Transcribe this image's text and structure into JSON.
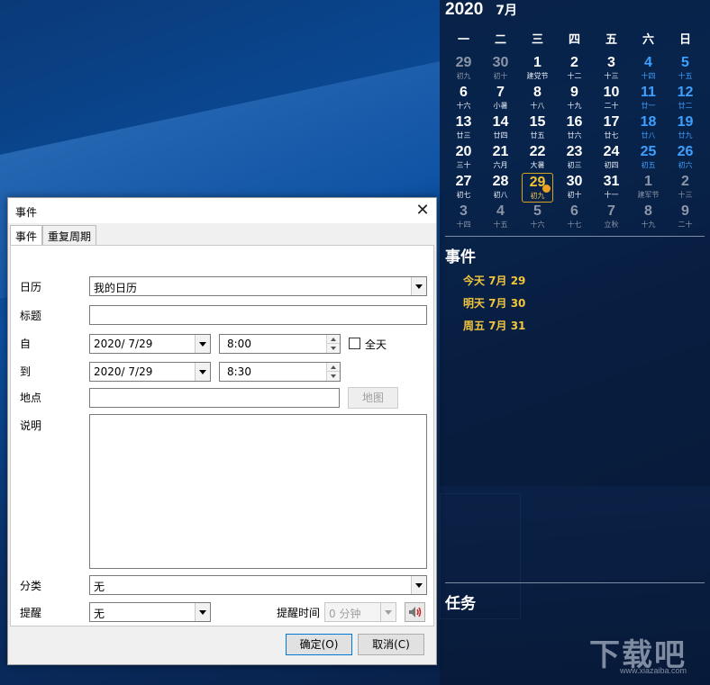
{
  "calendar": {
    "year": "2020",
    "month": "7月",
    "weekdays": [
      "一",
      "二",
      "三",
      "四",
      "五",
      "六",
      "日"
    ],
    "days": [
      {
        "n": "29",
        "l": "初九",
        "t": "other"
      },
      {
        "n": "30",
        "l": "初十",
        "t": "other"
      },
      {
        "n": "1",
        "l": "建党节",
        "t": "normal"
      },
      {
        "n": "2",
        "l": "十二",
        "t": "normal"
      },
      {
        "n": "3",
        "l": "十三",
        "t": "normal"
      },
      {
        "n": "4",
        "l": "十四",
        "t": "weekend"
      },
      {
        "n": "5",
        "l": "十五",
        "t": "weekend"
      },
      {
        "n": "6",
        "l": "十六",
        "t": "normal"
      },
      {
        "n": "7",
        "l": "小暑",
        "t": "normal"
      },
      {
        "n": "8",
        "l": "十八",
        "t": "normal"
      },
      {
        "n": "9",
        "l": "十九",
        "t": "normal"
      },
      {
        "n": "10",
        "l": "二十",
        "t": "normal"
      },
      {
        "n": "11",
        "l": "廿一",
        "t": "weekend"
      },
      {
        "n": "12",
        "l": "廿二",
        "t": "weekend"
      },
      {
        "n": "13",
        "l": "廿三",
        "t": "normal"
      },
      {
        "n": "14",
        "l": "廿四",
        "t": "normal"
      },
      {
        "n": "15",
        "l": "廿五",
        "t": "normal"
      },
      {
        "n": "16",
        "l": "廿六",
        "t": "normal"
      },
      {
        "n": "17",
        "l": "廿七",
        "t": "normal"
      },
      {
        "n": "18",
        "l": "廿八",
        "t": "weekend"
      },
      {
        "n": "19",
        "l": "廿九",
        "t": "weekend"
      },
      {
        "n": "20",
        "l": "三十",
        "t": "normal"
      },
      {
        "n": "21",
        "l": "六月",
        "t": "normal"
      },
      {
        "n": "22",
        "l": "大暑",
        "t": "normal"
      },
      {
        "n": "23",
        "l": "初三",
        "t": "normal"
      },
      {
        "n": "24",
        "l": "初四",
        "t": "normal"
      },
      {
        "n": "25",
        "l": "初五",
        "t": "weekend"
      },
      {
        "n": "26",
        "l": "初六",
        "t": "weekend"
      },
      {
        "n": "27",
        "l": "初七",
        "t": "normal"
      },
      {
        "n": "28",
        "l": "初八",
        "t": "normal"
      },
      {
        "n": "29",
        "l": "初九",
        "t": "today"
      },
      {
        "n": "30",
        "l": "初十",
        "t": "normal"
      },
      {
        "n": "31",
        "l": "十一",
        "t": "normal"
      },
      {
        "n": "1",
        "l": "建军节",
        "t": "other"
      },
      {
        "n": "2",
        "l": "十三",
        "t": "other"
      },
      {
        "n": "3",
        "l": "十四",
        "t": "other"
      },
      {
        "n": "4",
        "l": "十五",
        "t": "other"
      },
      {
        "n": "5",
        "l": "十六",
        "t": "other"
      },
      {
        "n": "6",
        "l": "十七",
        "t": "other"
      },
      {
        "n": "7",
        "l": "立秋",
        "t": "other"
      },
      {
        "n": "8",
        "l": "十九",
        "t": "other"
      },
      {
        "n": "9",
        "l": "二十",
        "t": "other"
      }
    ],
    "events_title": "事件",
    "events": [
      "今天 7月 29",
      "明天 7月 30",
      "周五 7月 31"
    ],
    "tasks_title": "任务",
    "colors": {
      "weekend": "#3ea0ff",
      "today": "#f5c232",
      "event_text": "#f2c53b"
    }
  },
  "dialog": {
    "title": "事件",
    "tabs": [
      "事件",
      "重复周期"
    ],
    "calendar_label": "日历",
    "calendar_value": "我的日历",
    "title_label": "标题",
    "title_value": "",
    "from_label": "自",
    "from_date": "2020/  7/29",
    "from_time": "8:00",
    "allday_label": "全天",
    "to_label": "到",
    "to_date": "2020/  7/29",
    "to_time": "8:30",
    "location_label": "地点",
    "location_value": "",
    "map_button": "地图",
    "desc_label": "说明",
    "desc_value": "",
    "category_label": "分类",
    "category_value": "无",
    "reminder_label": "提醒",
    "reminder_value": "无",
    "reminder_time_label": "提醒时间",
    "reminder_time_value": "0 分钟",
    "ok_button": "确定(O)",
    "cancel_button": "取消(C)"
  },
  "watermark": {
    "text": "下载吧",
    "url": "www.xiazaiba.com"
  }
}
